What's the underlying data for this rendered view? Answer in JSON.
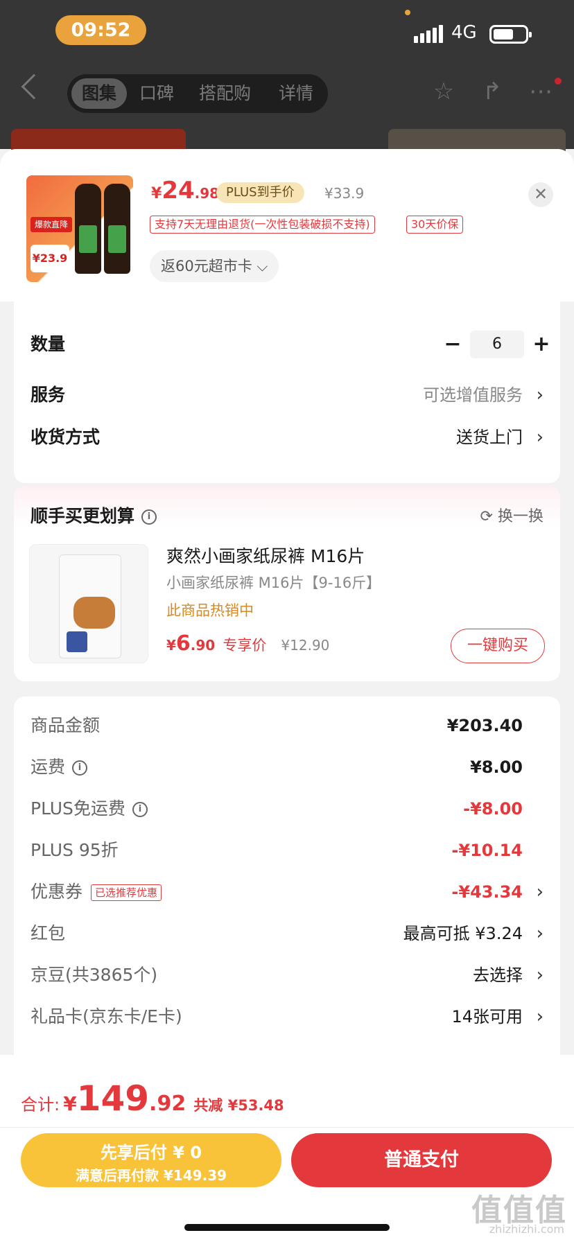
{
  "status_bar": {
    "time": "09:52",
    "network": "4G"
  },
  "nav": {
    "tabs": [
      "图集",
      "口碑",
      "搭配购",
      "详情"
    ],
    "active_tab": 0
  },
  "product": {
    "price_symbol": "¥",
    "price_int": "24",
    "price_dec": ".98",
    "plus_tag": "PLUS到手价",
    "original_price": "¥33.9",
    "service_tag_1": "支持7天无理由退货(一次性包装破损不支持)",
    "service_tag_2": "30天价保",
    "cash_chip": "返60元超市卡 ⌵",
    "thumb_badge": "爆款直降",
    "thumb_price": "¥23.9"
  },
  "options": {
    "quantity_label": "数量",
    "quantity_value": "6",
    "service_label": "服务",
    "service_value": "可选增值服务",
    "delivery_label": "收货方式",
    "delivery_value": "送货上门"
  },
  "recommend": {
    "title": "顺手买更划算",
    "refresh": "换一换",
    "item_name": "爽然小画家纸尿裤 M16片",
    "item_spec": "小画家纸尿裤 M16片【9-16斤】",
    "item_hot": "此商品热销中",
    "price_symbol": "¥",
    "price_int": "6",
    "price_dec": ".90",
    "price_tag": "专享价",
    "orig_price": "¥12.90",
    "buy_button": "一键购买"
  },
  "summary": {
    "rows": [
      {
        "label": "商品金额",
        "value": "¥203.40"
      },
      {
        "label": "运费",
        "value": "¥8.00"
      },
      {
        "label": "PLUS免运费",
        "value": "-¥8.00"
      },
      {
        "label": "PLUS 95折",
        "value": "-¥10.14"
      },
      {
        "label": "优惠券",
        "tag": "已选推荐优惠",
        "value": "-¥43.34"
      },
      {
        "label": "红包",
        "value": "最高可抵 ¥3.24"
      },
      {
        "label": "京豆(共3865个)",
        "value": "去选择"
      },
      {
        "label": "礼品卡(京东卡/E卡)",
        "value": "14张可用"
      }
    ]
  },
  "footer": {
    "total_label": "合计:",
    "total_symbol": "¥",
    "total_int": "149",
    "total_dec": ".92",
    "saved": "共减 ¥53.48",
    "pay_later_line1": "先享后付 ¥ 0",
    "pay_later_line2": "满意后再付款 ¥149.39",
    "pay_button": "普通支付"
  },
  "watermark": {
    "logo": "值值值",
    "site": "zhizhizhi.com"
  },
  "colors": {
    "accent": "#e4393c",
    "plus_gold": "#f7e5b8",
    "pay_later": "#f8c338"
  }
}
